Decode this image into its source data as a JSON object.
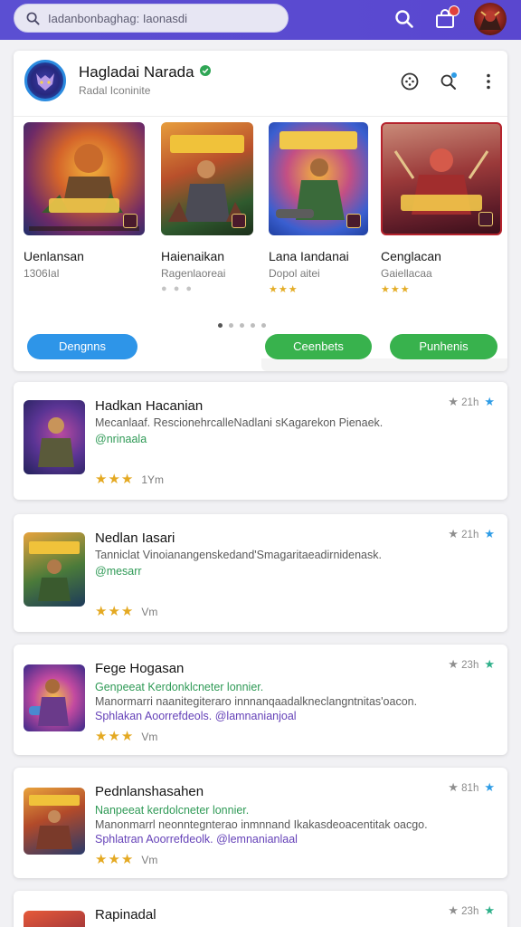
{
  "search": {
    "text": "Iadanbonbaghag: Iaonasdi"
  },
  "developer": {
    "name": "Hagladai  Narada",
    "subtitle": "Radal Iconinite"
  },
  "featured": [
    {
      "title": "Uenlansan",
      "subtitle": "1306Ial",
      "indicator": "dots"
    },
    {
      "title": "Haienaikan",
      "subtitle": "Ragenlaoreai",
      "indicator": "dots"
    },
    {
      "title": "Lana Iandanai",
      "subtitle": "Dopol aitei",
      "indicator": "stars",
      "rating": 3
    },
    {
      "title": "Cenglacan",
      "subtitle": "Gaiellacaa",
      "indicator": "stars",
      "rating": 3
    }
  ],
  "buttons": {
    "first": "Dengnns",
    "second": "Ceenbets",
    "third": "Punhenis"
  },
  "cards": [
    {
      "title": "Hadkan Hacanian",
      "lines": [
        {
          "text": "Mecanlaaf. RescionehrcalleNadlani sKagarekon Pienaek.",
          "style": "desc"
        },
        {
          "text": "@nrinaala",
          "style": "green"
        }
      ],
      "rating": 3,
      "age": "1Ym",
      "downloads": "21h"
    },
    {
      "title": "Nedlan Iasari",
      "lines": [
        {
          "text": "Tanniclat Vinoianangenskedand'Smagaritaeadirnidenask.",
          "style": "desc"
        },
        {
          "text": "@mesarr",
          "style": "green"
        }
      ],
      "rating": 3,
      "age": "Vm",
      "downloads": "21h"
    },
    {
      "title": "Fege Hogasan",
      "lines": [
        {
          "text": "Genpeeat  Kerdonklcneter lonnier.",
          "style": "green"
        },
        {
          "text": "Manormarri  naanitegiteraro  innnanqaadalkneclangntnitas'oacon.",
          "style": "desc"
        },
        {
          "text": "Sphlakan Aoorrefdeols. @lamnanianjoal",
          "style": "purple"
        }
      ],
      "rating": 3,
      "age": "Vm",
      "downloads": "23h"
    },
    {
      "title": "Pednlanshasahen",
      "lines": [
        {
          "text": "Nanpeeat  kerdolcneter lonnier.",
          "style": "green"
        },
        {
          "text": "Manonmarrl  neonntegnterao  inmnnand Ikakasdeoacentitak oacgo.",
          "style": "desc"
        },
        {
          "text": "Sphlatran Aoorrefdeolk. @lemnanianlaal",
          "style": "purple"
        }
      ],
      "rating": 3,
      "age": "Vm",
      "downloads": "81h"
    },
    {
      "title": "Rapinadal",
      "lines": [],
      "rating": 0,
      "age": "",
      "downloads": "23h"
    }
  ],
  "colors": {
    "topbar": "#5a47cf",
    "blue_button": "#2e95e8",
    "green_button": "#38b24d",
    "star": "#e4a922",
    "bookmark_star": "#2e9ce6"
  }
}
